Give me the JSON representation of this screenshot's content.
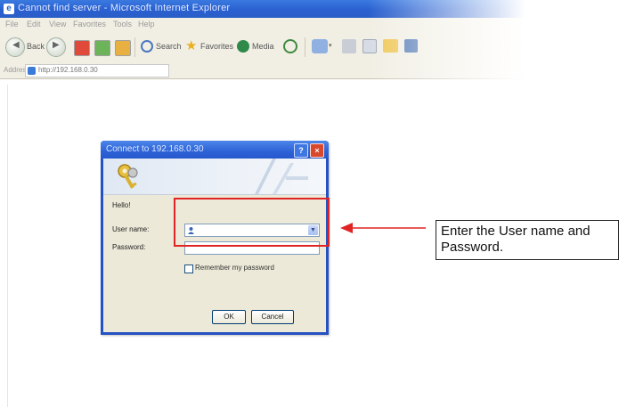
{
  "browser": {
    "title": "Cannot find server - Microsoft Internet Explorer",
    "menu": [
      "File",
      "Edit",
      "View",
      "Favorites",
      "Tools",
      "Help"
    ],
    "toolbar": {
      "back_label": "Back",
      "search_label": "Search",
      "favorites_label": "Favorites",
      "media_label": "Media"
    },
    "address_label": "Address",
    "address_url": "http://192.168.0.30"
  },
  "dialog": {
    "title": "Connect to 192.168.0.30",
    "help_glyph": "?",
    "close_glyph": "×",
    "welcome": "Hello!",
    "username_label": "User name:",
    "password_label": "Password:",
    "username_value": "",
    "password_value": "",
    "remember_label": "Remember my password",
    "ok_label": "OK",
    "cancel_label": "Cancel"
  },
  "annotation": {
    "callout_text": "Enter the User name and Password.",
    "highlight_color": "#e02424"
  }
}
